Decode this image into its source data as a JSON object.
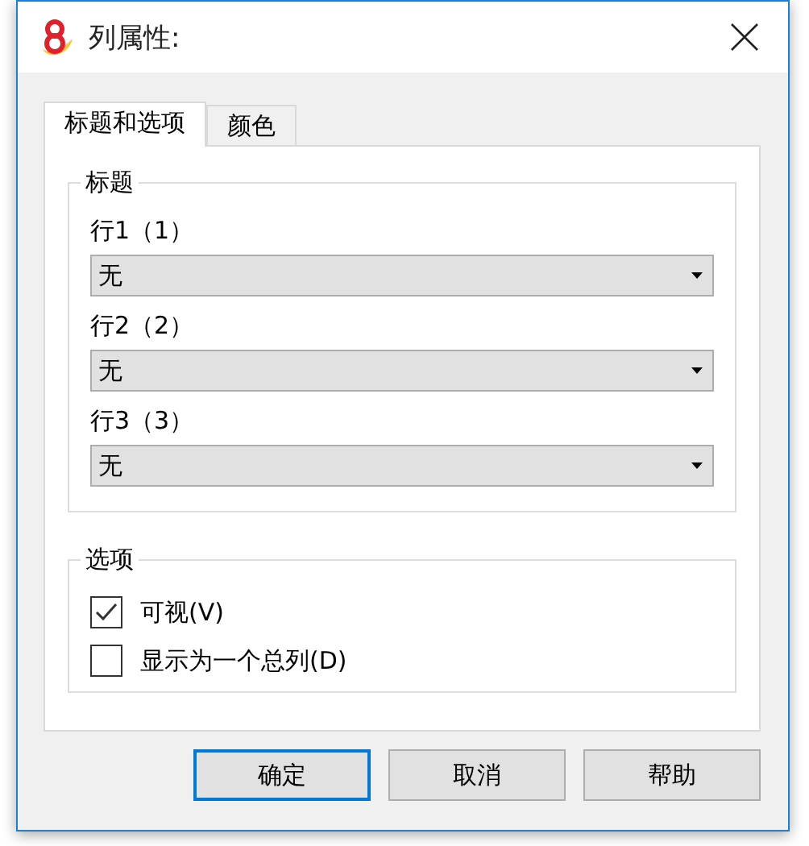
{
  "window": {
    "title": "列属性:"
  },
  "tabs": [
    {
      "label": "标题和选项",
      "selected": true
    },
    {
      "label": "颜色",
      "selected": false
    }
  ],
  "title_group": {
    "legend": "标题",
    "rows": [
      {
        "label": "行1（1）",
        "value": "无"
      },
      {
        "label": "行2（2）",
        "value": "无"
      },
      {
        "label": "行3（3）",
        "value": "无"
      }
    ]
  },
  "options_group": {
    "legend": "选项",
    "items": [
      {
        "label": "可视(V)",
        "checked": true
      },
      {
        "label": "显示为一个总列(D)",
        "checked": false
      }
    ]
  },
  "buttons": [
    {
      "label": "确定",
      "default": true
    },
    {
      "label": "取消",
      "default": false
    },
    {
      "label": "帮助",
      "default": false
    }
  ]
}
